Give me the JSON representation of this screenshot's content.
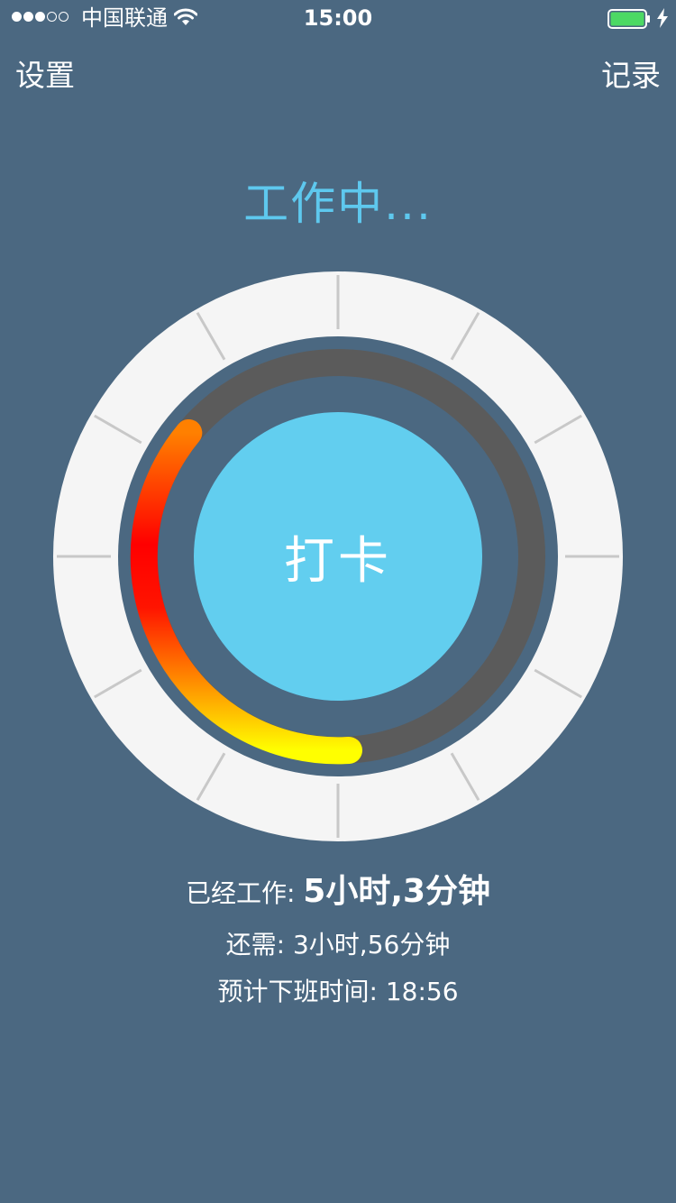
{
  "status_bar": {
    "carrier": "中国联通",
    "time": "15:00",
    "signal_strength": 3,
    "signal_max": 5,
    "wifi_icon": "wifi-icon",
    "battery_icon": "battery-icon",
    "battery_level": 1.0,
    "battery_color": "#4cd964",
    "charging_icon": "charging-bolt-icon"
  },
  "nav": {
    "left_label": "设置",
    "right_label": "记录"
  },
  "work_status": "工作中...",
  "dial": {
    "progress": 0.5,
    "progress_gradient": [
      "#ffff00",
      "#ffa000",
      "#ff1400",
      "#ff0000",
      "#ff8000"
    ],
    "track_color": "#5b5b5b",
    "face_color": "#f5f5f5",
    "tick_color": "#c8c8c8",
    "tick_count": 12
  },
  "punch_button": {
    "label": "打卡",
    "color": "#62ceef"
  },
  "stats": {
    "worked_label": "已经工作: ",
    "worked_value": "5小时,3分钟",
    "remaining_text": "还需: 3小时,56分钟",
    "offwork_text": "预计下班时间: 18:56"
  },
  "colors": {
    "background": "#4b6881",
    "accent": "#5ec8ee"
  }
}
